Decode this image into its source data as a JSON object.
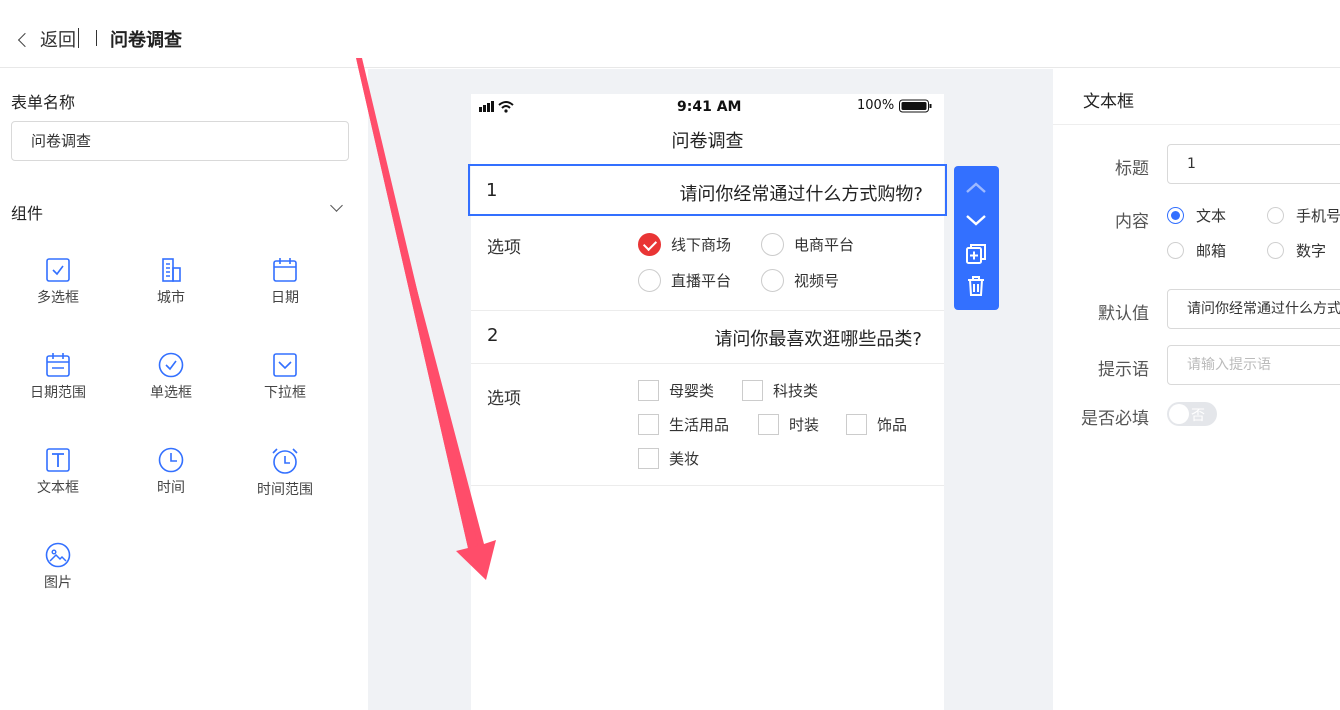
{
  "header": {
    "back_label": "返回",
    "title": "问卷调查"
  },
  "left": {
    "form_name_label": "表单名称",
    "form_name_value": "问卷调查",
    "components_label": "组件",
    "components": [
      "多选框",
      "城市",
      "日期",
      "日期范围",
      "单选框",
      "下拉框",
      "文本框",
      "时间",
      "时间范围",
      "图片"
    ]
  },
  "phone": {
    "status_time": "9:41 AM",
    "status_battery": "100%",
    "title": "问卷调查",
    "q1": {
      "num": "1",
      "text": "请问你经常通过什么方式购物?",
      "options_label": "选项",
      "options": [
        "线下商场",
        "电商平台",
        "直播平台",
        "视频号"
      ]
    },
    "q2": {
      "num": "2",
      "text": "请问你最喜欢逛哪些品类?",
      "options_label": "选项",
      "options": [
        "母婴类",
        "科技类",
        "生活用品",
        "时装",
        "饰品",
        "美妆"
      ]
    }
  },
  "right": {
    "header": "文本框",
    "title_label": "标题",
    "title_value": "1",
    "content_label": "内容",
    "content_options": [
      "文本",
      "手机号",
      "邮箱",
      "数字"
    ],
    "default_label": "默认值",
    "default_value": "请问你经常通过什么方式购物?",
    "hint_label": "提示语",
    "hint_placeholder": "请输入提示语",
    "required_label": "是否必填",
    "required_value": "否"
  },
  "colors": {
    "accent": "#3370ff",
    "selected_radio": "#e93535",
    "arrow": "#ff4d6a"
  }
}
